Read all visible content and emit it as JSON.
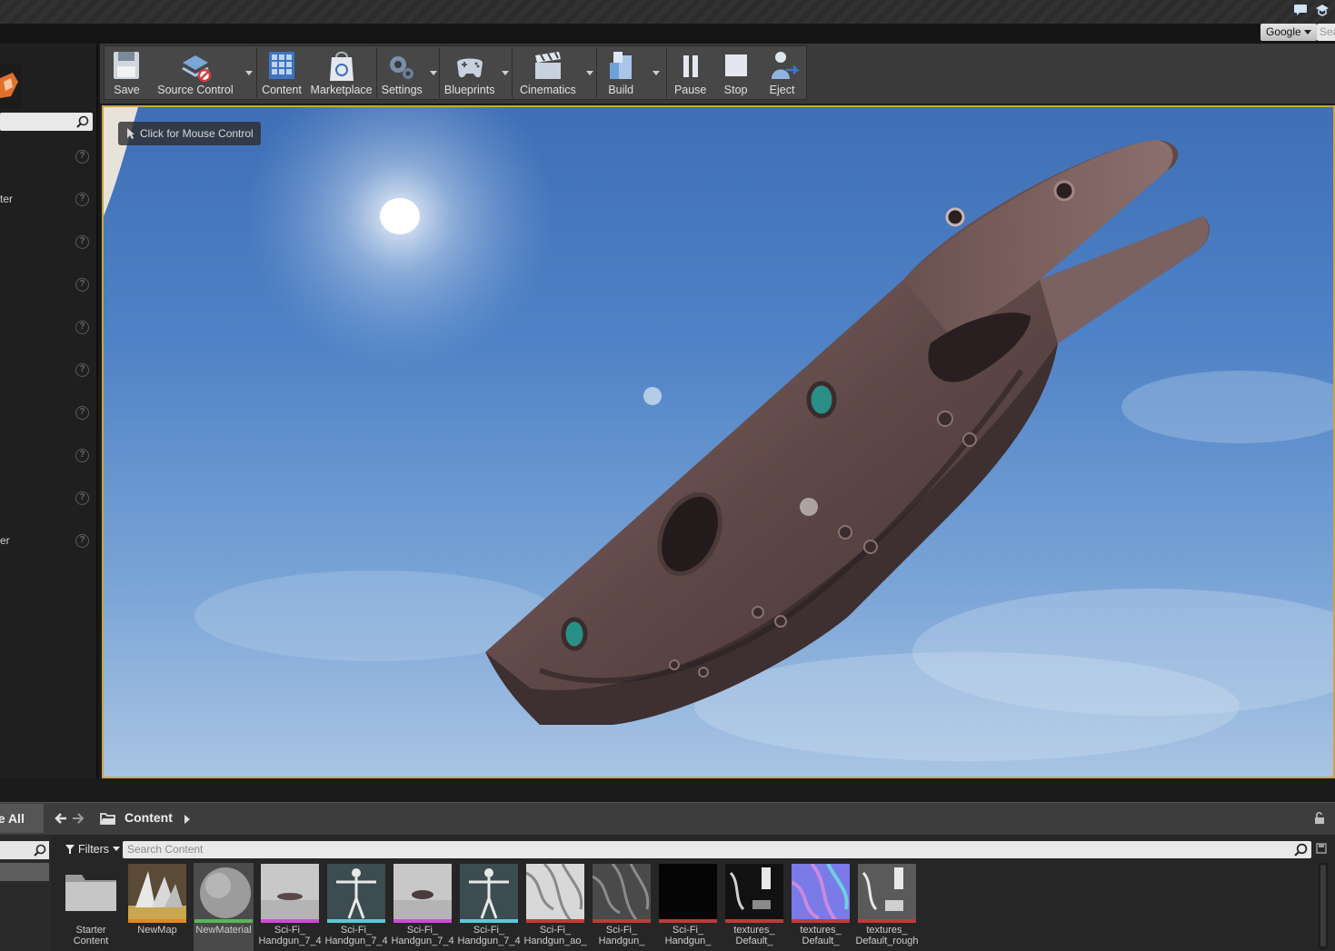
{
  "title_bar": {
    "icons": [
      "chat-icon",
      "graduation-cap-icon"
    ]
  },
  "header": {
    "search_provider": "Google",
    "help_search_placeholder": "Sea"
  },
  "left_panel": {
    "place_items": [
      {
        "label": ""
      },
      {
        "label": "ter"
      },
      {
        "label": ""
      },
      {
        "label": ""
      },
      {
        "label": ""
      },
      {
        "label": ""
      },
      {
        "label": ""
      },
      {
        "label": ""
      },
      {
        "label": ""
      },
      {
        "label": "er"
      }
    ]
  },
  "toolbar": {
    "save": "Save",
    "source_control": "Source Control",
    "content": "Content",
    "marketplace": "Marketplace",
    "settings": "Settings",
    "blueprints": "Blueprints",
    "cinematics": "Cinematics",
    "build": "Build",
    "pause": "Pause",
    "stop": "Stop",
    "eject": "Eject"
  },
  "viewport": {
    "mouse_control_hint": "Click for Mouse Control"
  },
  "content_browser": {
    "save_all": "ve All",
    "breadcrumb": "Content",
    "filters_label": "Filters",
    "search_placeholder": "Search Content",
    "assets": [
      {
        "name": "Starter\nContent",
        "type": "folder",
        "bar_color": ""
      },
      {
        "name": "NewMap",
        "type": "map",
        "bar_color": "#e08a1e"
      },
      {
        "name": "NewMaterial",
        "type": "material",
        "bar_color": "#5ab55a"
      },
      {
        "name": "Sci-Fi_\nHandgun_7_4",
        "type": "static-mesh",
        "bar_color": "#d04ad6"
      },
      {
        "name": "Sci-Fi_\nHandgun_7_4",
        "type": "skeleton",
        "bar_color": "#5ac8d8"
      },
      {
        "name": "Sci-Fi_\nHandgun_7_4",
        "type": "skeletal-mesh",
        "bar_color": "#d04ad6"
      },
      {
        "name": "Sci-Fi_\nHandgun_7_4",
        "type": "physics-asset",
        "bar_color": "#5ac8d8"
      },
      {
        "name": "Sci-Fi_\nHandgun_ao_",
        "type": "texture",
        "bar_color": "#c03a3a"
      },
      {
        "name": "Sci-Fi_\nHandgun_",
        "type": "texture",
        "bar_color": "#c03a3a"
      },
      {
        "name": "Sci-Fi_\nHandgun_",
        "type": "texture",
        "bar_color": "#c03a3a"
      },
      {
        "name": "textures_\nDefault_",
        "type": "texture",
        "bar_color": "#c03a3a"
      },
      {
        "name": "textures_\nDefault_",
        "type": "texture",
        "bar_color": "#c03a3a"
      },
      {
        "name": "textures_\nDefault_rough",
        "type": "texture",
        "bar_color": "#c03a3a"
      }
    ]
  },
  "colors": {
    "viewport_border": "#c8a640",
    "accent_select": "#4a4a4a"
  }
}
